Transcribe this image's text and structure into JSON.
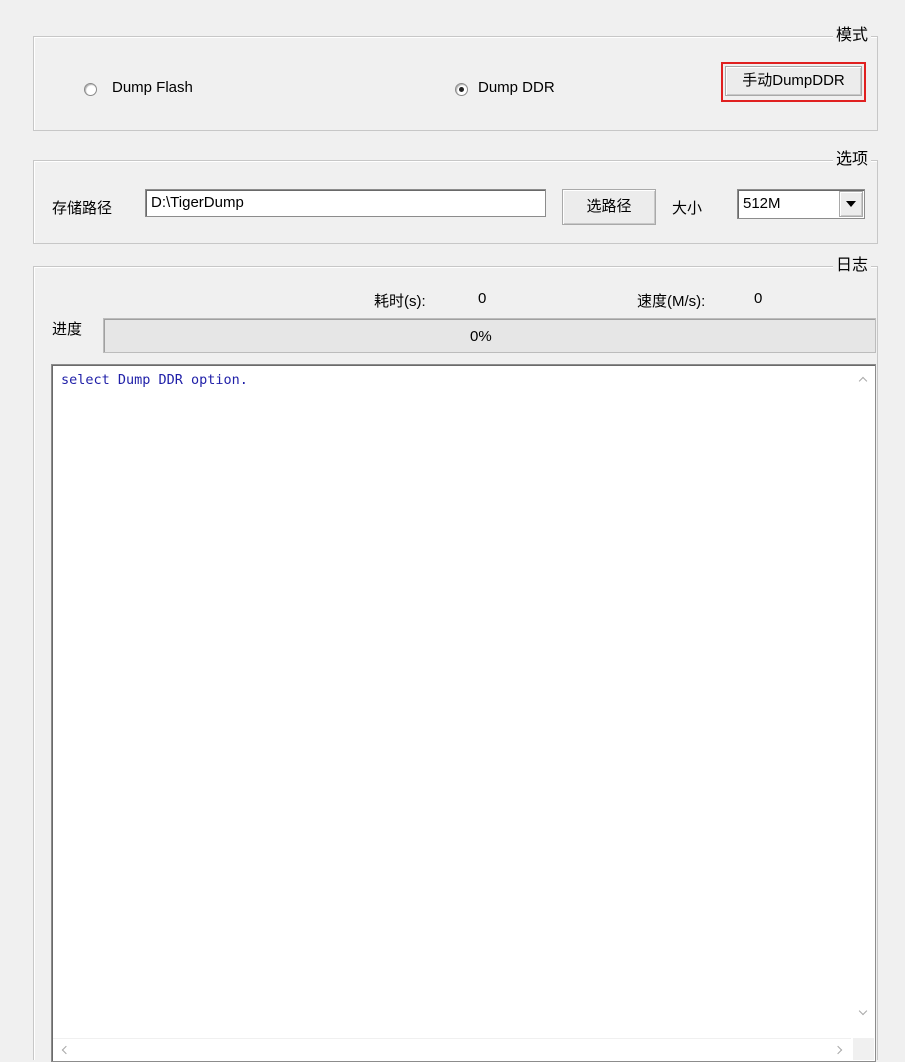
{
  "mode_group": {
    "title": "模式",
    "radio_flash_label": "Dump Flash",
    "radio_ddr_label": "Dump DDR",
    "manual_button_label": "手动DumpDDR"
  },
  "options_group": {
    "title": "选项",
    "path_label": "存储路径",
    "path_value": "D:\\TigerDump",
    "browse_button_label": "选路径",
    "size_label": "大小",
    "size_value": "512M"
  },
  "log_group": {
    "title": "日志",
    "elapsed_label": "耗时(s):",
    "elapsed_value": "0",
    "speed_label": "速度(M/s):",
    "speed_value": "0",
    "progress_label": "进度",
    "progress_percent_text": "0%",
    "progress_value": 0,
    "log_lines": [
      "select Dump DDR option."
    ]
  },
  "colors": {
    "highlight_border": "#e02020",
    "log_text": "#1f1fa8"
  }
}
